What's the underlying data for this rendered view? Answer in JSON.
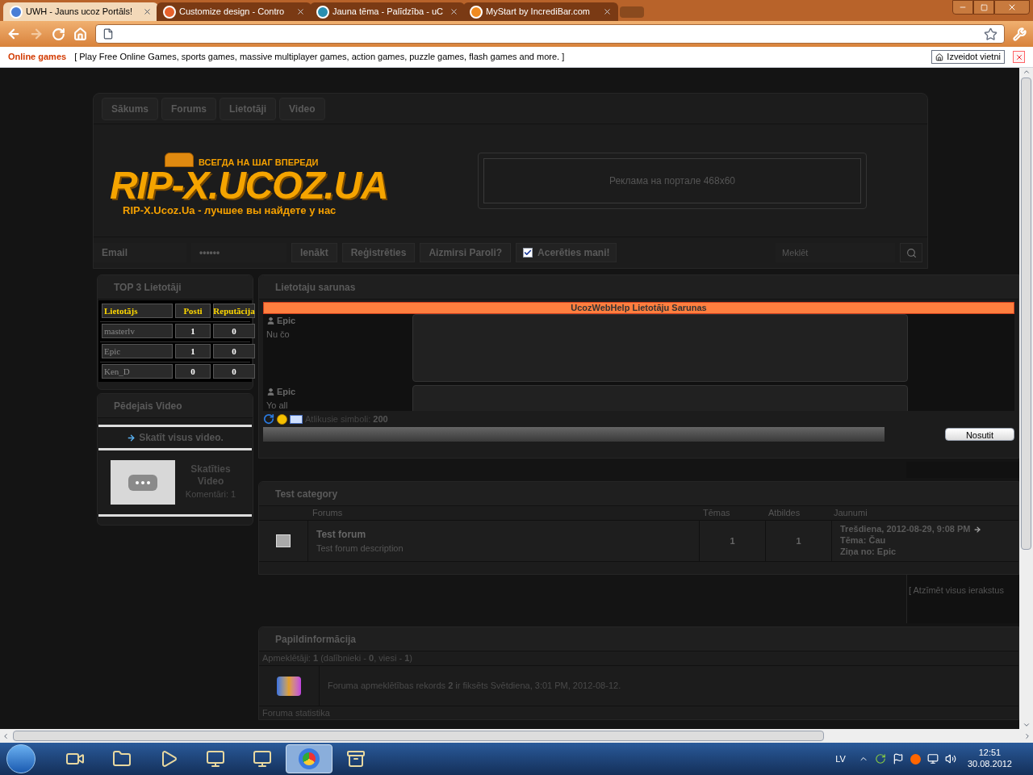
{
  "browser": {
    "tabs": [
      {
        "title": "UWH - Jauns ucoz Portāls!",
        "selected": true
      },
      {
        "title": "Customize design - Contro",
        "selected": false
      },
      {
        "title": "Jauna tēma - Palīdzība - uC",
        "selected": false
      },
      {
        "title": "MyStart by IncrediBar.com",
        "selected": false
      }
    ]
  },
  "incredibar": {
    "brand": "Online games",
    "text": "[ Play Free Online Games, sports games, massive multiplayer games, action games, puzzle games, flash games and more. ]",
    "button": "Izveidot vietni"
  },
  "site": {
    "nav": [
      "Sākums",
      "Forums",
      "Lietotāji",
      "Video"
    ],
    "logo": {
      "tagline": "ВСЕГДА НА ШАГ ВПЕРЕДИ",
      "title": "RIP-X.UCOZ.UA",
      "subtitle": "RIP-X.Ucoz.Ua - лучшее вы найдете у нас"
    },
    "ad": "Реклама на портале 468x60",
    "login": {
      "email_placeholder": "Email",
      "password": "••••••",
      "login": "Ienākt",
      "register": "Reģistrēties",
      "forgot": "Aizmirsi Paroli?",
      "remember": {
        "label": "Acerēties mani!",
        "checked": true
      },
      "search_placeholder": "Meklēt"
    }
  },
  "top_users": {
    "title": "TOP 3 Lietotāji",
    "columns": [
      "Lietotājs",
      "Posti",
      "Reputācija"
    ],
    "rows": [
      [
        "masterlv",
        "1",
        "0"
      ],
      [
        "Epic",
        "1",
        "0"
      ],
      [
        "Ken_D",
        "0",
        "0"
      ]
    ]
  },
  "last_video": {
    "title": "Pēdejais Video",
    "all_link": "Skatīt visus video.",
    "video_title": "Skatīties Video",
    "comments": "Komentāri: 1"
  },
  "chat": {
    "title": "Lietotaju sarunas",
    "banner": "UcozWebHelp Lietotāju Sarunas",
    "messages": [
      {
        "user": "Epic",
        "text": "Nu čo"
      },
      {
        "user": "Epic",
        "text": "Yo all"
      }
    ],
    "remaining_label": "Atlikusie simboli:",
    "remaining": "200",
    "send": "Nosutit"
  },
  "category": {
    "title": "Test category",
    "columns": [
      "Forums",
      "Tēmas",
      "Atbildes",
      "Jaunumi"
    ],
    "forums": [
      {
        "name": "Test forum",
        "description": "Test forum description",
        "topics": "1",
        "replies": "1",
        "last_date": "Trešdiena, 2012-08-29, 9:08 PM",
        "last_topic": "Tēma: Čau",
        "last_by": "Ziņa no: Epic"
      }
    ],
    "mark_read": "[ Atzīmēt visus ierakstus"
  },
  "info": {
    "title": "Papildinformācija",
    "visitors": "Apmeklētāji: **1**  (dalībnieki - **0**, viesi - **1**)",
    "record": "Foruma apmeklētības rekords **2** ir fiksēts Svētdiena, 3:01 PM, 2012-08-12.",
    "stats": "Foruma statistika"
  },
  "taskbar": {
    "apps": [
      {
        "selected": false
      },
      {
        "selected": false
      },
      {
        "selected": false
      },
      {
        "selected": false
      },
      {
        "selected": false
      },
      {
        "selected": true
      },
      {
        "selected": false
      }
    ],
    "lang": "LV",
    "time": "12:51",
    "date": "30.08.2012"
  }
}
